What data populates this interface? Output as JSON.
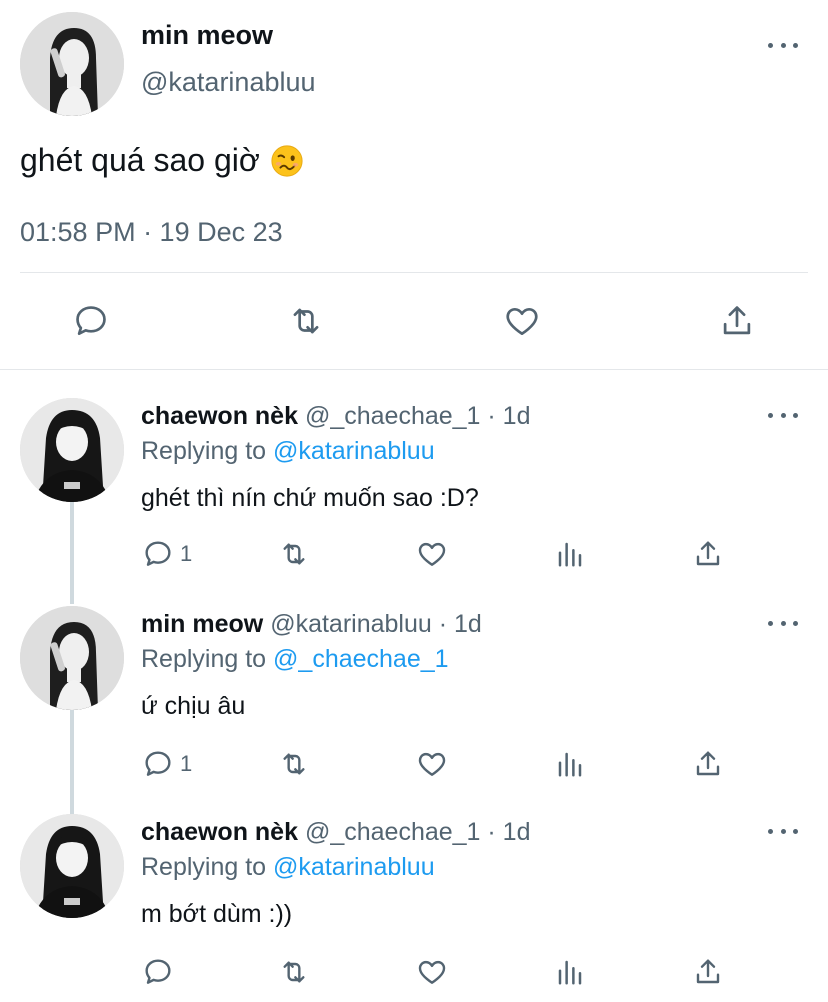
{
  "main_tweet": {
    "author_name": "min meow",
    "author_handle": "@katarinabluu",
    "text": "ghét quá sao giờ",
    "emoji": "woozy-face",
    "timestamp": "01:58 PM · 19 Dec 23"
  },
  "replies": [
    {
      "author_name": "chaewon nèk",
      "author_handle": "@_chaechae_1 · 1d",
      "replying_prefix": "Replying to",
      "replying_to": "@katarinabluu",
      "text": "ghét thì nín chứ muốn sao :D?",
      "reply_count": "1"
    },
    {
      "author_name": "min meow",
      "author_handle": "@katarinabluu · 1d",
      "replying_prefix": "Replying to",
      "replying_to": "@_chaechae_1",
      "text": "ứ chịu âu",
      "reply_count": "1"
    },
    {
      "author_name": "chaewon nèk",
      "author_handle": "@_chaechae_1 · 1d",
      "replying_prefix": "Replying to",
      "replying_to": "@katarinabluu",
      "text": "m bớt dùm :))",
      "reply_count": ""
    }
  ],
  "icons": {
    "reply": "speech-bubble-icon",
    "retweet": "retweet-icon",
    "like": "heart-icon",
    "views": "bar-chart-icon",
    "share": "share-icon",
    "more": "more-horizontal-icon"
  },
  "colors": {
    "link": "#1d9bf0",
    "secondary_text": "#536471",
    "divider": "#e4e7ea",
    "thread_line": "#cfd9de"
  }
}
